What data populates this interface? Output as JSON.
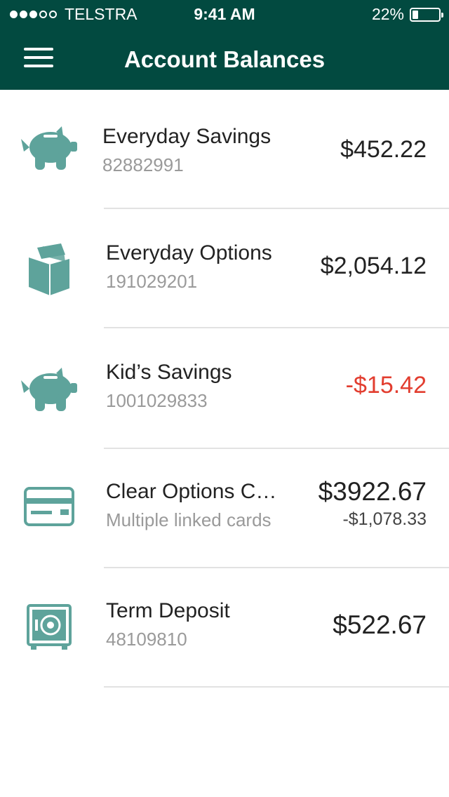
{
  "status_bar": {
    "carrier": "TELSTRA",
    "time": "9:41 AM",
    "battery": "22%",
    "battery_level": 0.22
  },
  "header": {
    "title": "Account Balances",
    "color": "#024a40"
  },
  "accounts": [
    {
      "icon": "piggy-bank-icon",
      "name": "Everyday Savings",
      "number": "82882991",
      "balance": "$452.22"
    },
    {
      "icon": "wallet-icon",
      "name": "Everyday Options",
      "number": "191029201",
      "balance": "$2,054.12"
    },
    {
      "icon": "piggy-bank-icon",
      "name": "Kid’s Savings",
      "number": "1001029833",
      "balance": "-$15.42",
      "balance_color": "#e23d2f"
    },
    {
      "icon": "credit-card-icon",
      "name": "Clear Options C…",
      "number": "Multiple linked cards",
      "balance": "$3922.67",
      "secondary_balance": "-$1,078.33"
    },
    {
      "icon": "safe-icon",
      "name": "Term Deposit",
      "number": "48109810",
      "balance": "$522.67"
    }
  ],
  "icon_color": "#5ea39b"
}
